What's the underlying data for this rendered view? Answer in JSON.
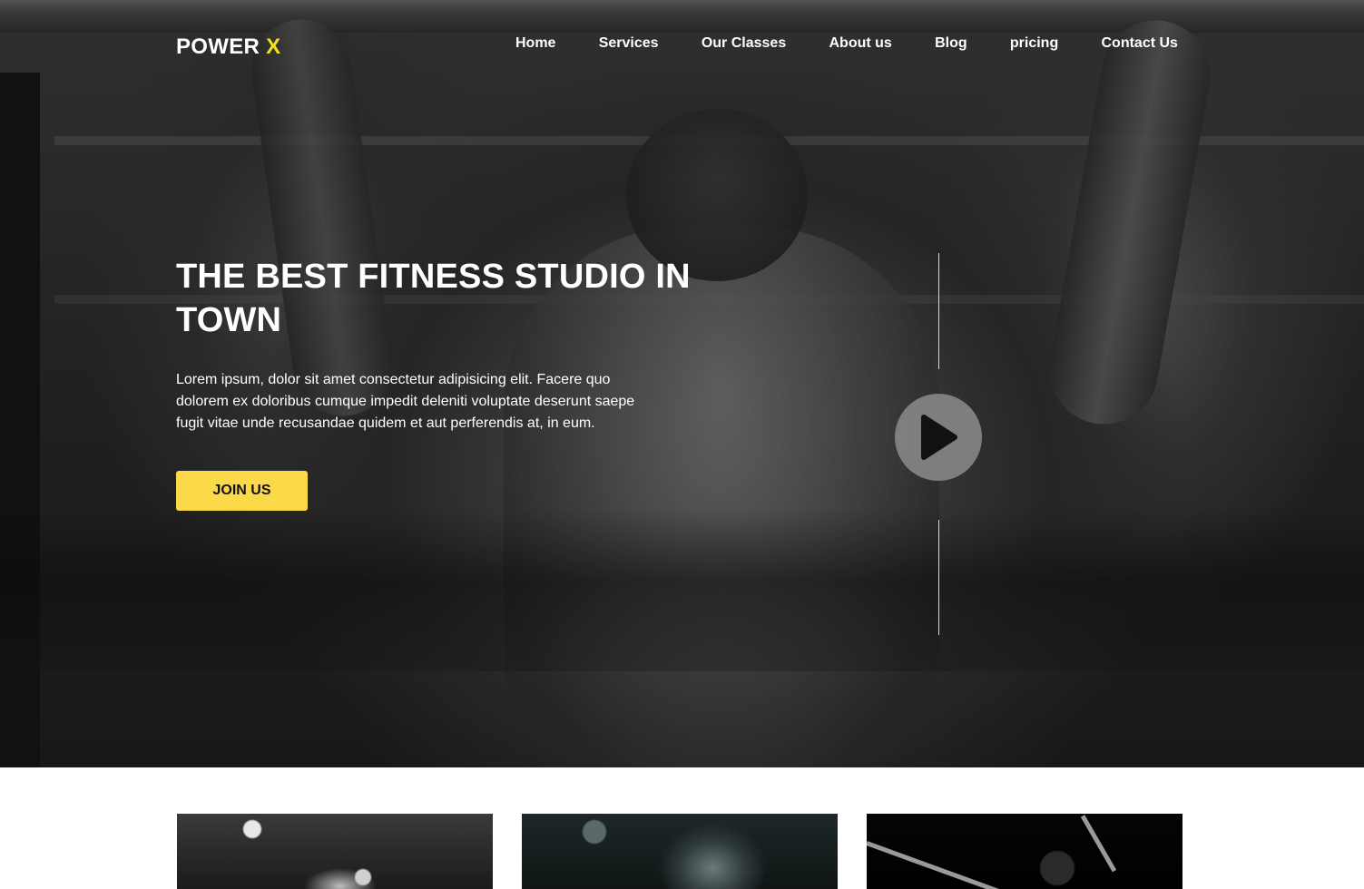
{
  "brand": {
    "name": "POWER",
    "accent": "X",
    "accent_color": "#f5e31a"
  },
  "nav": {
    "items": [
      {
        "label": "Home"
      },
      {
        "label": "Services"
      },
      {
        "label": "Our Classes"
      },
      {
        "label": "About us"
      },
      {
        "label": "Blog"
      },
      {
        "label": "pricing"
      },
      {
        "label": "Contact Us"
      }
    ]
  },
  "hero": {
    "title": "THE BEST FITNESS STUDIO IN TOWN",
    "description": "Lorem ipsum, dolor sit amet consectetur adipisicing elit. Facere quo dolorem ex doloribus cumque impedit deleniti voluptate deserunt saepe fugit vitae unde recusandae quidem et aut perferendis at, in eum.",
    "cta_label": "JOIN US",
    "cta_color": "#fcd948",
    "play_icon": "play-icon"
  },
  "colors": {
    "text_light": "#ffffff",
    "page_background": "#ffffff"
  }
}
